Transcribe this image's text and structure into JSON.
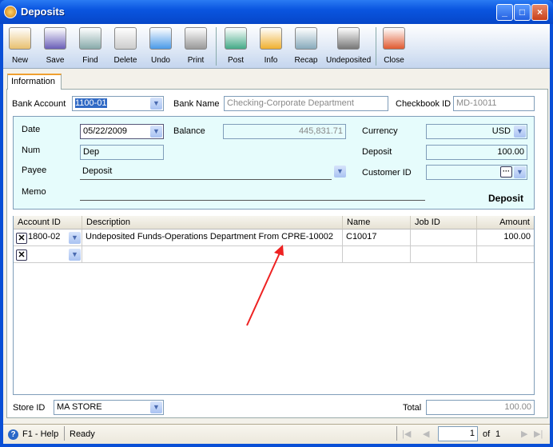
{
  "window": {
    "title": "Deposits"
  },
  "toolbar": [
    {
      "id": "new",
      "label": "New",
      "icon": "new-icon",
      "color": "#e8c070"
    },
    {
      "id": "save",
      "label": "Save",
      "icon": "floppy-disk-icon",
      "color": "#6a5fb8"
    },
    {
      "id": "find",
      "label": "Find",
      "icon": "binoculars-icon",
      "color": "#8aa"
    },
    {
      "id": "delete",
      "label": "Delete",
      "icon": "recycle-bin-icon",
      "color": "#ccc"
    },
    {
      "id": "undo",
      "label": "Undo",
      "icon": "undo-arrow-icon",
      "color": "#4a9ae8"
    },
    {
      "id": "print",
      "label": "Print",
      "icon": "printer-icon",
      "color": "#999"
    },
    {
      "id": "post",
      "label": "Post",
      "icon": "post-check-icon",
      "color": "#4a8"
    },
    {
      "id": "info",
      "label": "Info",
      "icon": "info-badge-icon",
      "color": "#f0b030"
    },
    {
      "id": "recap",
      "label": "Recap",
      "icon": "recap-icon",
      "color": "#8ab"
    },
    {
      "id": "undeposited",
      "label": "Undeposited",
      "icon": "safe-icon",
      "color": "#777"
    },
    {
      "id": "close",
      "label": "Close",
      "icon": "close-window-icon",
      "color": "#e05a30"
    }
  ],
  "tab": {
    "label": "Information"
  },
  "header": {
    "bank_account_label": "Bank Account",
    "bank_account": "1100-01",
    "bank_name_label": "Bank Name",
    "bank_name": "Checking-Corporate Department",
    "checkbook_label": "Checkbook ID",
    "checkbook": "MD-10011"
  },
  "form": {
    "date_label": "Date",
    "date": "05/22/2009",
    "balance_label": "Balance",
    "balance": "445,831.71",
    "currency_label": "Currency",
    "currency": "USD",
    "num_label": "Num",
    "num": "Dep",
    "deposit_label": "Deposit",
    "deposit": "100.00",
    "payee_label": "Payee",
    "payee": "Deposit",
    "customer_label": "Customer ID",
    "customer": "",
    "memo_label": "Memo",
    "memo": "",
    "type_caption": "Deposit"
  },
  "grid": {
    "columns": [
      "Account ID",
      "Description",
      "Name",
      "Job ID",
      "Amount"
    ],
    "rows": [
      {
        "account": "1800-02",
        "description": "Undeposited Funds-Operations Department From CPRE-10002",
        "name": "C10017",
        "job": "",
        "amount": "100.00"
      },
      {
        "account": "",
        "description": "",
        "name": "",
        "job": "",
        "amount": ""
      }
    ]
  },
  "footer": {
    "store_label": "Store ID",
    "store": "MA STORE",
    "total_label": "Total",
    "total": "100.00"
  },
  "status": {
    "help": "F1 - Help",
    "state": "Ready",
    "page": "1",
    "of_label": "of",
    "pages": "1"
  },
  "annotation": {
    "arrow_color": "#ee2222"
  }
}
